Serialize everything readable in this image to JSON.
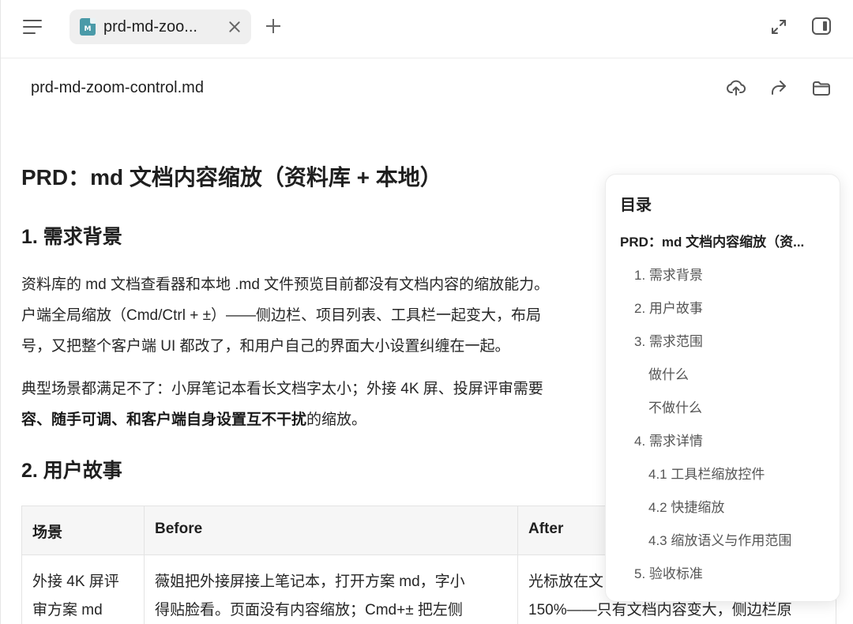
{
  "tabbar": {
    "tab_label": "prd-md-zoo...",
    "tab_icon_text": "M"
  },
  "file": {
    "name": "prd-md-zoom-control.md"
  },
  "doc": {
    "title": "PRD：md 文档内容缩放（资料库 + 本地）",
    "h_background": "1. 需求背景",
    "p1_line1": "资料库的 md 文档查看器和本地 .md 文件预览目前都没有文档内容的缩放能力。",
    "p1_line2": "户端全局缩放（Cmd/Ctrl + ±）——侧边栏、项目列表、工具栏一起变大，布局",
    "p1_line3": "号，又把整个客户端 UI 都改了，和用户自己的界面大小设置纠缠在一起。",
    "p2_line1": "典型场景都满足不了：小屏笔记本看长文档字太小；外接 4K 屏、投屏评审需要",
    "p2_line2_bold": "容、随手可调、和客户端自身设置互不干扰",
    "p2_line2_rest": "的缩放。",
    "h_stories": "2. 用户故事",
    "table": {
      "headers": [
        "场景",
        "Before",
        "After"
      ],
      "row1": {
        "scene_l1": "外接 4K 屏评",
        "scene_l2": "审方案 md",
        "before_l1": "薇姐把外接屏接上笔记本，打开方案 md，字小",
        "before_l2": "得贴脸看。页面没有内容缩放；Cmd+± 把左侧",
        "after_l1": "光标放在文",
        "after_l2": "150%——只有文档内容变大，侧边栏原"
      }
    }
  },
  "toc": {
    "title": "目录",
    "items": [
      {
        "label": "PRD：md 文档内容缩放（资...",
        "level": 0
      },
      {
        "label": "1. 需求背景",
        "level": 1
      },
      {
        "label": "2. 用户故事",
        "level": 1
      },
      {
        "label": "3. 需求范围",
        "level": 1
      },
      {
        "label": "做什么",
        "level": 2
      },
      {
        "label": "不做什么",
        "level": 2
      },
      {
        "label": "4. 需求详情",
        "level": 1
      },
      {
        "label": "4.1 工具栏缩放控件",
        "level": 2
      },
      {
        "label": "4.2 快捷缩放",
        "level": 2
      },
      {
        "label": "4.3 缩放语义与作用范围",
        "level": 2
      },
      {
        "label": "5. 验收标准",
        "level": 1
      }
    ]
  },
  "icons": {
    "menu": "hamburger-menu-icon",
    "file": "markdown-file-icon",
    "close": "close-icon",
    "add": "plus-icon",
    "expand": "expand-icon",
    "panel": "side-panel-icon",
    "upload": "cloud-upload-icon",
    "share": "share-forward-icon",
    "folder": "folder-icon"
  }
}
